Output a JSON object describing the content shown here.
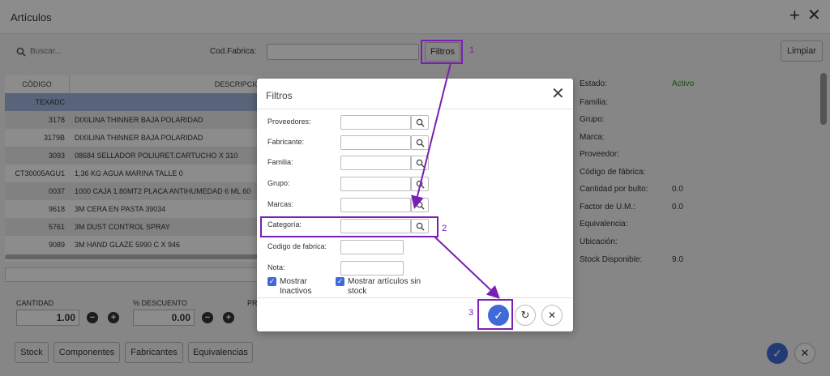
{
  "header": {
    "title": "Artículos",
    "add_icon": "+",
    "close_icon": "✕"
  },
  "search": {
    "placeholder": "Buscar...",
    "cod_fabrica_label": "Cod.Fabrica:",
    "filtros_label": "Filtros",
    "limpiar_label": "Limpiar"
  },
  "table": {
    "headers": [
      "CÓDIGO",
      "DESCRIPCIÓN"
    ],
    "rows": [
      {
        "code": "TEXADC",
        "desc": ""
      },
      {
        "code": "3178",
        "desc": "DIXILINA THINNER BAJA POLARIDAD"
      },
      {
        "code": "3179B",
        "desc": "DIXILINA THINNER BAJA POLARIDAD"
      },
      {
        "code": "3093",
        "desc": "08684 SELLADOR POLIURET.CARTUCHO X 310"
      },
      {
        "code": "CT30005AGU1",
        "desc": "1,36 KG AGUA MARINA TALLE 0"
      },
      {
        "code": "0037",
        "desc": "1000 CAJA 1.80MT2 PLACA ANTIHUMEDAD 6 ML 60"
      },
      {
        "code": "9618",
        "desc": "3M CERA EN PASTA 39034"
      },
      {
        "code": "5761",
        "desc": "3M DUST CONTROL SPRAY"
      },
      {
        "code": "9089",
        "desc": "3M HAND GLAZE 5990 C X 946"
      }
    ]
  },
  "bottom": {
    "cantidad_label": "CANTIDAD",
    "cantidad_value": "1.00",
    "descuento_label": "% DESCUENTO",
    "descuento_value": "0.00",
    "pr_label": "PR",
    "buttons": [
      "Stock",
      "Componentes",
      "Fabricantes",
      "Equivalencias"
    ]
  },
  "details": {
    "estado_label": "Estado:",
    "estado_value": "Activo",
    "familia_label": "Familia:",
    "grupo_label": "Grupo:",
    "marca_label": "Marca:",
    "proveedor_label": "Proveedor:",
    "codigo_fabrica_label": "Código de fábrica:",
    "cantidad_bulto_label": "Cantidad por bulto:",
    "cantidad_bulto_value": "0.0",
    "factor_label": "Factor de U.M.:",
    "factor_value": "0.0",
    "equivalencia_label": "Equivalencia:",
    "ubicacion_label": "Ubicación:",
    "stock_label": "Stock Disponible:",
    "stock_value": "9.0"
  },
  "modal": {
    "title": "Filtros",
    "proveedores": "Proveedores:",
    "fabricante": "Fabricante:",
    "familia": "Familia:",
    "grupo": "Grupo:",
    "marcas": "Marcas:",
    "categoria": "Categoría:",
    "codigo_fabrica": "Codigo de fabrica:",
    "nota": "Nota:",
    "chk1_line1": "Mostrar",
    "chk1_line2": "Inactivos",
    "chk2_line1": "Mostrar artículos sin",
    "chk2_line2": "stock"
  },
  "annotations": {
    "n1": "1",
    "n2": "2",
    "n3": "3"
  },
  "colors": {
    "accent": "#3f6ad8",
    "annotation": "#7a1fb5",
    "active_green": "#2a8a2a",
    "selected_row": "#9fb7dd"
  }
}
